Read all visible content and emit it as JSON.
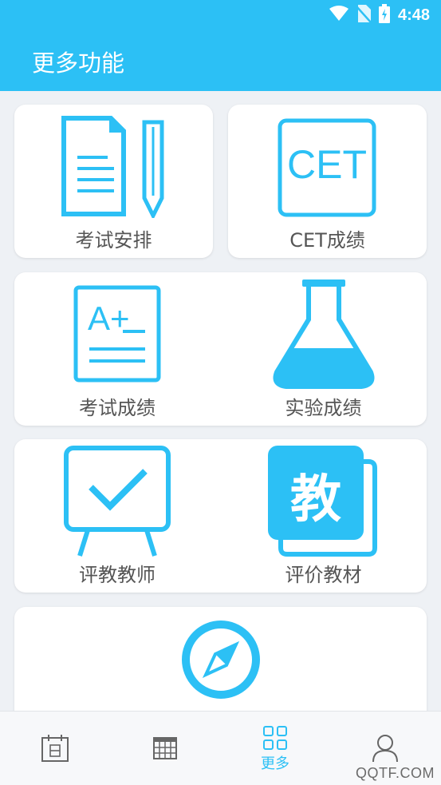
{
  "status": {
    "time": "4:48"
  },
  "header": {
    "title": "更多功能"
  },
  "tiles": [
    {
      "label": "考试安排",
      "icon": "exam-schedule-icon"
    },
    {
      "label": "CET成绩",
      "icon": "cet-icon",
      "icon_text": "CET"
    },
    {
      "label": "考试成绩",
      "icon": "exam-grade-icon",
      "icon_text": "A+"
    },
    {
      "label": "实验成绩",
      "icon": "flask-icon"
    },
    {
      "label": "评教教师",
      "icon": "checkmark-board-icon"
    },
    {
      "label": "评价教材",
      "icon": "textbook-icon",
      "icon_text": "教"
    },
    {
      "label": "",
      "icon": "compass-icon"
    }
  ],
  "tabbar": {
    "tabs": [
      {
        "icon": "calendar-icon",
        "label": ""
      },
      {
        "icon": "timetable-icon",
        "label": ""
      },
      {
        "icon": "grid-icon",
        "label": "更多",
        "active": true
      },
      {
        "icon": "person-icon",
        "label": ""
      }
    ]
  },
  "watermark": "QQTF.COM",
  "colors": {
    "accent": "#2cc0f5",
    "background": "#eef1f5",
    "label": "#555555"
  }
}
